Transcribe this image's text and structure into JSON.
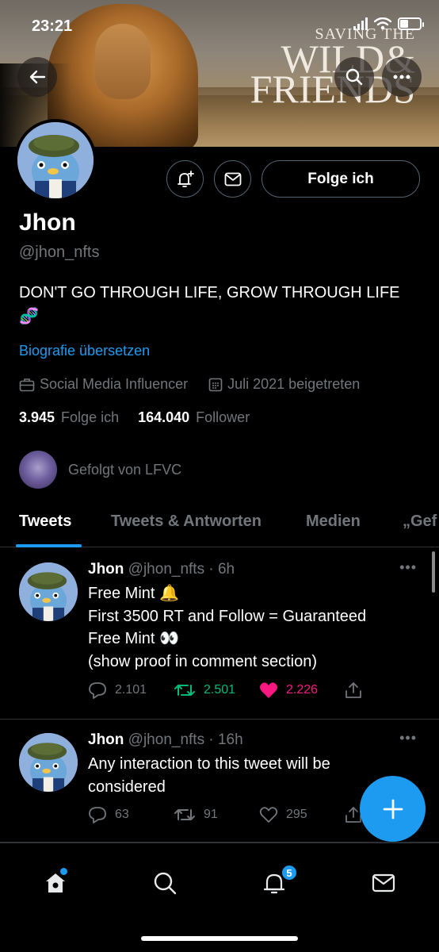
{
  "status_bar": {
    "time": "23:21"
  },
  "banner": {
    "line1": "SAVING THE",
    "line2": "WILD&",
    "line3": "FRIENDS"
  },
  "profile": {
    "follow_button": "Folge ich",
    "name": "Jhon",
    "handle": "@jhon_nfts",
    "bio": "DON'T GO THROUGH LIFE, GROW THROUGH LIFE",
    "bio_emoji": "🧬",
    "translate_link": "Biografie übersetzen",
    "category": "Social Media Influencer",
    "joined": "Juli 2021 beigetreten",
    "following_count": "3.945",
    "following_label": "Folge ich",
    "followers_count": "164.040",
    "followers_label": "Follower",
    "followed_by": "Gefolgt von LFVC"
  },
  "tabs": [
    {
      "label": "Tweets",
      "active": true
    },
    {
      "label": "Tweets & Antworten"
    },
    {
      "label": "Medien"
    },
    {
      "label": "„Gef"
    }
  ],
  "tweets": [
    {
      "name": "Jhon",
      "handle": "@jhon_nfts",
      "time": "· 6h",
      "lines": [
        "Free Mint 🔔",
        "First 3500 RT and Follow  = Guaranteed",
        "Free Mint 👀",
        "(show proof in comment section)"
      ],
      "replies": "2.101",
      "retweets": "2.501",
      "likes": "2.226",
      "retweeted": true,
      "liked": true
    },
    {
      "name": "Jhon",
      "handle": "@jhon_nfts",
      "time": "· 16h",
      "lines": [
        "Any interaction to this tweet will be",
        "considered"
      ],
      "replies": "63",
      "retweets": "91",
      "likes": "295",
      "retweeted": false,
      "liked": false
    }
  ],
  "bottom_nav": {
    "notification_count": "5"
  },
  "colors": {
    "accent": "#1d9bf0",
    "retweet": "#00ba7c",
    "like": "#f91880",
    "muted": "#71767b",
    "border": "#2f3336"
  }
}
